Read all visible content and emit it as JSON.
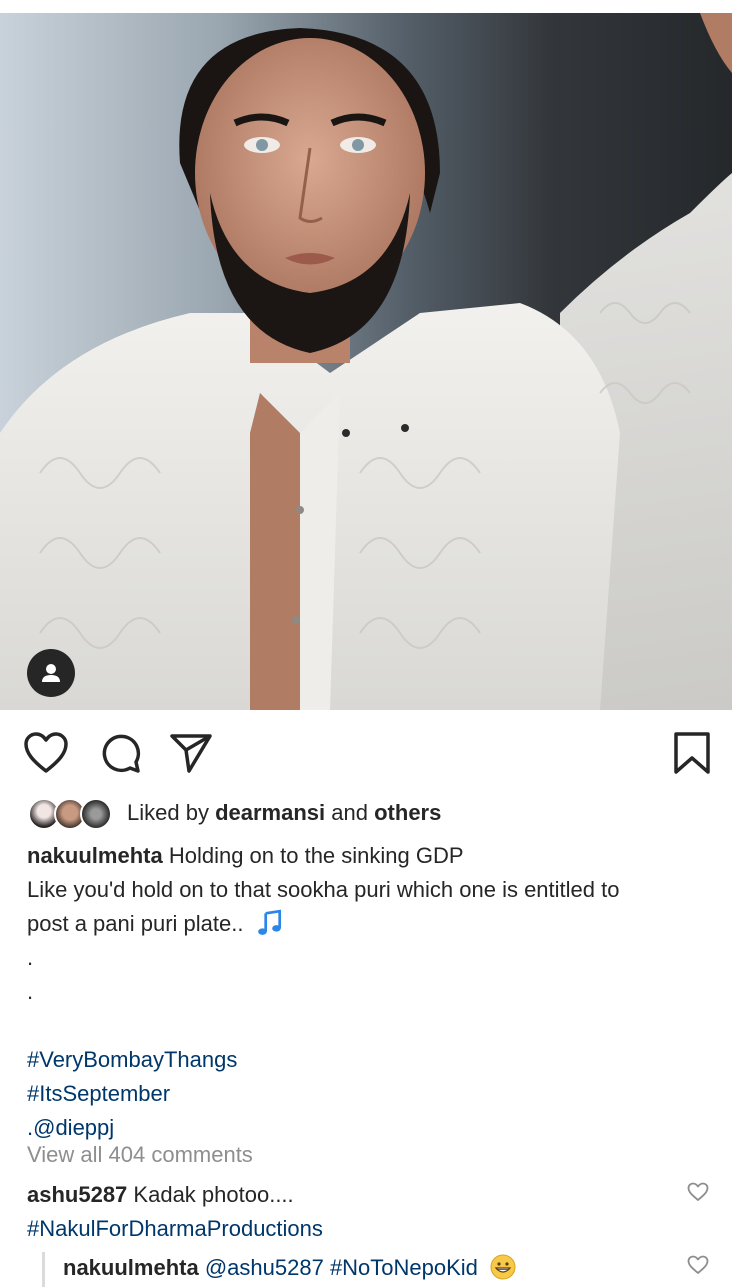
{
  "post": {
    "colors": {
      "link": "#00376b",
      "muted": "#8e8e8e",
      "text": "#262626"
    }
  },
  "icons": {
    "like": "heart-icon",
    "comment": "comment-icon",
    "share": "share-icon",
    "save": "bookmark-icon",
    "tagged": "person-icon",
    "music": "music-note-icon",
    "emoji": "grinning-face-icon"
  },
  "likes": {
    "prefix": "Liked by",
    "user": "dearmansi",
    "and": "and",
    "others": "others"
  },
  "caption": {
    "username": "nakuulmehta",
    "line1": "Holding on to the sinking GDP",
    "line2": "Like you'd hold on to that sookha puri which one is entitled to",
    "line3": "post a pani puri plate..",
    "dot1": ".",
    "dot2": ".",
    "hashtag1": "#VeryBombayThangs",
    "hashtag2": "#ItsSeptember",
    "mention": ".@dieppj"
  },
  "comments": {
    "view_all": "View all 404 comments",
    "items": [
      {
        "username": "ashu5287",
        "text": "Kadak photoo....",
        "hashtag": "#NakulForDharmaProductions"
      }
    ],
    "reply": {
      "username": "nakuulmehta",
      "mention": "@ashu5287",
      "hashtag": "#NoToNepoKid"
    }
  }
}
